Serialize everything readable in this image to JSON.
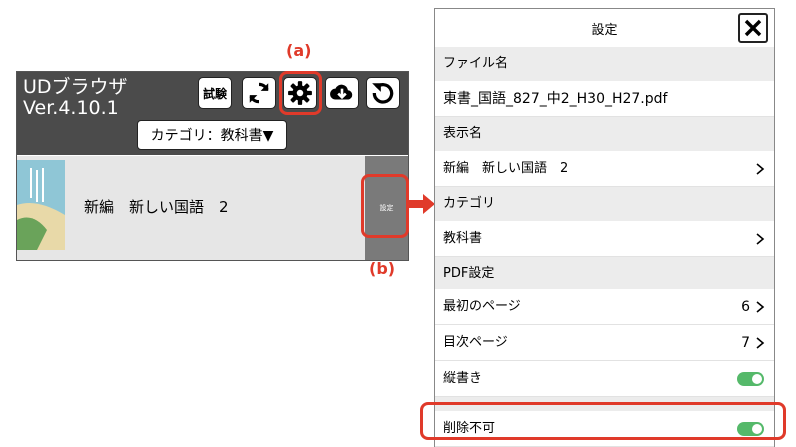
{
  "markers": {
    "a": "(a)",
    "b": "(b)"
  },
  "app": {
    "title": "UDブラウザ\nVer.4.10.1",
    "trial_label": "試験",
    "category_dropdown": "カテゴリ：教科書▼",
    "book_title": "新編　新しい国語　2",
    "settings_btn_label": "設定",
    "toolbar_icons": [
      "refresh-icon",
      "gear-icon",
      "cloud-download-icon",
      "reload-icon"
    ]
  },
  "settings": {
    "title": "設定",
    "close_icon": "close-icon",
    "sections": {
      "file_name": "ファイル名",
      "display_name": "表示名",
      "category": "カテゴリ",
      "pdf_settings": "PDF設定"
    },
    "file_name_value": "東書_国語_827_中2_H30_H27.pdf",
    "display_name_value": "新編　新しい国語　2",
    "category_value": "教科書",
    "first_page": {
      "label": "最初のページ",
      "value": "6"
    },
    "toc_page": {
      "label": "目次ページ",
      "value": "7"
    },
    "vertical": {
      "label": "縦書き",
      "on": true
    },
    "no_delete": {
      "label": "削除不可",
      "on": true
    }
  },
  "colors": {
    "highlight": "#e03a2a",
    "toggle_on": "#55b96a",
    "header_bg": "#4b4b4b"
  }
}
